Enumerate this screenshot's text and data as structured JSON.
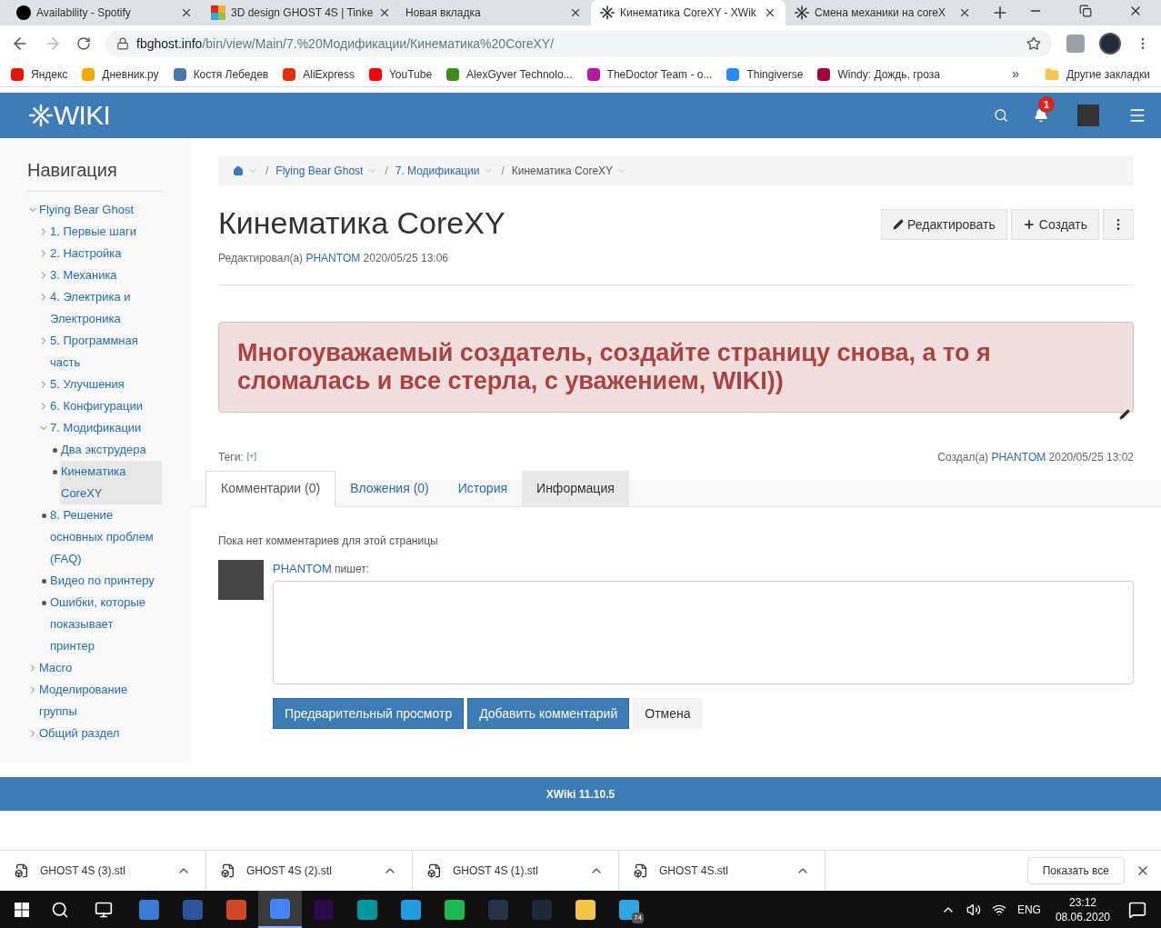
{
  "browser_tabs": [
    {
      "title": "Availability - Spotify",
      "selected": false
    },
    {
      "title": "3D design GHOST 4S | Tinke",
      "selected": false
    },
    {
      "title": "Новая вкладка",
      "selected": false
    },
    {
      "title": "Кинематика CoreXY - XWik",
      "selected": true
    },
    {
      "title": "Смена механики на coreX",
      "selected": false
    }
  ],
  "address": {
    "host": "fbghost.info",
    "path": "/bin/view/Main/7.%20Модификации/Кинематика%20CoreXY/"
  },
  "bookmarks": [
    {
      "label": "Яндекс",
      "color": "#e61400"
    },
    {
      "label": "Дневник.ру",
      "color": "#f2a900"
    },
    {
      "label": "Костя Лебедев",
      "color": "#4a76a8"
    },
    {
      "label": "AliExpress",
      "color": "#e62e04"
    },
    {
      "label": "YouTube",
      "color": "#ff0000"
    },
    {
      "label": "AlexGyver Technolo...",
      "color": "#3b8c1a"
    },
    {
      "label": "TheDoctor Team - о...",
      "color": "#b5179e"
    },
    {
      "label": "Thingiverse",
      "color": "#248bfb"
    },
    {
      "label": "Windy: Дождь, гроза",
      "color": "#a4003a"
    }
  ],
  "bookmarks_more": "»",
  "other_bookmarks": "Другие закладки",
  "wiki_header": {
    "logo": "WIKI",
    "notifications": "1"
  },
  "navigation": {
    "title": "Навигация",
    "items": [
      {
        "label": "Flying Bear Ghost",
        "kind": "branch",
        "expanded": true,
        "selected": false,
        "children": [
          {
            "label": "1. Первые шаги",
            "kind": "branch",
            "expanded": false,
            "selected": false
          },
          {
            "label": "2. Настройка",
            "kind": "branch",
            "expanded": false,
            "selected": false
          },
          {
            "label": "3. Механика",
            "kind": "branch",
            "expanded": false,
            "selected": false
          },
          {
            "label": "4. Электрика и Электроника",
            "kind": "branch",
            "expanded": false,
            "selected": false
          },
          {
            "label": "5. Программная часть",
            "kind": "branch",
            "expanded": false,
            "selected": false
          },
          {
            "label": "5. Улучшения",
            "kind": "branch",
            "expanded": false,
            "selected": false
          },
          {
            "label": "6. Конфигурации",
            "kind": "branch",
            "expanded": false,
            "selected": false
          },
          {
            "label": "7. Модификации",
            "kind": "branch",
            "expanded": true,
            "selected": false,
            "children": [
              {
                "label": "Два экструдера",
                "kind": "leaf",
                "selected": false
              },
              {
                "label": "Кинематика CoreXY",
                "kind": "leaf",
                "selected": true
              }
            ]
          },
          {
            "label": "8. Решение основных проблем (FAQ)",
            "kind": "leaf",
            "selected": false
          },
          {
            "label": "Видео по принтеру",
            "kind": "leaf",
            "selected": false
          },
          {
            "label": "Ошибки, которые показывает принтер",
            "kind": "leaf",
            "selected": false
          }
        ]
      },
      {
        "label": "Macro",
        "kind": "branch",
        "expanded": false,
        "selected": false
      },
      {
        "label": "Моделирование группы",
        "kind": "branch",
        "expanded": false,
        "selected": false
      },
      {
        "label": "Общий раздел",
        "kind": "branch",
        "expanded": false,
        "selected": false
      }
    ]
  },
  "breadcrumb": [
    {
      "separator": "/",
      "label": "Flying Bear Ghost"
    },
    {
      "separator": "/",
      "label": "7. Модификации"
    },
    {
      "separator": "/",
      "label": "Кинематика CoreXY"
    }
  ],
  "page": {
    "title": "Кинематика CoreXY",
    "edited_label": "Редактировал(а)",
    "edited_by": "PHANTOM",
    "edited_at": "2020/05/25 13:06",
    "edit_button": "Редактировать",
    "create_button": "Создать",
    "message": "Многоуважаемый создатель, создайте страницу снова, а то я сломалась и все стерла, с уважением, WIKI))",
    "tags_label": "Теги:",
    "tags_add": "[+]",
    "created_label": "Создал(а)",
    "created_by": "PHANTOM",
    "created_at": "2020/05/25 13:02"
  },
  "doc_tabs": [
    {
      "label": "Комментарии (0)",
      "selected": true,
      "highlighted": false
    },
    {
      "label": "Вложения (0)",
      "selected": false,
      "highlighted": false
    },
    {
      "label": "История",
      "selected": false,
      "highlighted": false
    },
    {
      "label": "Информация",
      "selected": false,
      "highlighted": true
    }
  ],
  "comments": {
    "empty": "Пока нет комментариев для этой страницы",
    "author": "PHANTOM",
    "writes": "пишет:",
    "preview_button": "Предварительный просмотр",
    "add_button": "Добавить комментарий",
    "cancel_button": "Отмена"
  },
  "footer": "XWiki 11.10.5",
  "downloads": [
    "GHOST 4S (3).stl",
    "GHOST 4S (2).stl",
    "GHOST 4S (1).stl",
    "GHOST 4S.stl"
  ],
  "show_all": "Показать все",
  "taskbar": {
    "apps": [
      {
        "color": "#3a7bd5",
        "active": false
      },
      {
        "color": "#2b579a",
        "active": false
      },
      {
        "color": "#d24726",
        "active": false
      },
      {
        "color": "#4285f4",
        "active": true
      },
      {
        "color": "#2a0b47",
        "active": false
      },
      {
        "color": "#00979c",
        "active": false
      },
      {
        "color": "#1e9ee0",
        "active": false
      },
      {
        "color": "#1db954",
        "active": false
      },
      {
        "color": "#243447",
        "active": false
      },
      {
        "color": "#1b2838",
        "active": false
      },
      {
        "color": "#f4c542",
        "active": false
      },
      {
        "color": "#2ca5e0",
        "active": false,
        "badge": "74"
      }
    ],
    "language": "ENG",
    "time": "23:12",
    "date": "08.06.2020"
  }
}
